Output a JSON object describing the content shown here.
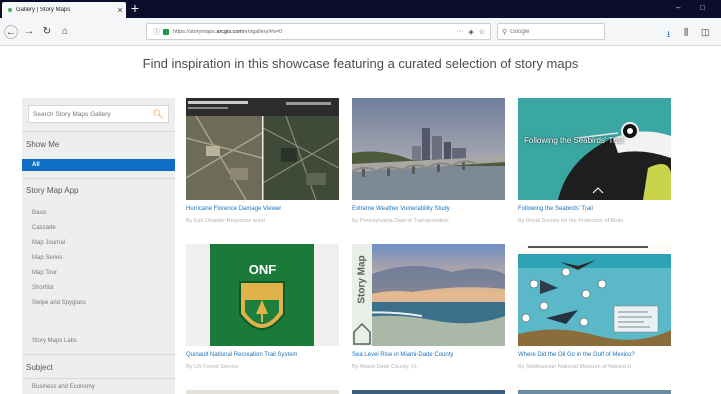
{
  "browser": {
    "tab_title": "Gallery | Story Maps",
    "tab_close": "×",
    "new_tab": "+",
    "minimize": "–",
    "maximize": "□",
    "url_prefix": "https://storymaps.",
    "url_domain": "arcgis.com",
    "url_suffix": "/en/gallery/#s=0",
    "url_more": "···",
    "search_placeholder": "Google",
    "icons": [
      "back-arrow-icon",
      "forward-arrow-icon",
      "reload-icon",
      "home-icon",
      "info-icon",
      "lock-icon",
      "pocket-icon",
      "bookmark-star-icon",
      "search-icon",
      "download-icon",
      "library-icon",
      "sidebar-icon"
    ]
  },
  "header": {
    "headline": "Find inspiration in this showcase featuring a curated selection of story maps"
  },
  "sidebar": {
    "search_placeholder": "Search Story Maps Gallery",
    "show_me": "Show Me",
    "all": "All",
    "story_map_app": "Story Map App",
    "app_items": [
      "Basic",
      "Cascade",
      "Map Journal",
      "Map Series",
      "Map Tour",
      "Shortlist",
      "Swipe and Spyglass"
    ],
    "labs": "Story Maps Labs",
    "subject": "Subject",
    "subject_items": [
      "Business and Economy"
    ]
  },
  "gallery": {
    "cards": [
      {
        "title": "Hurricane Florence Damage Viewer",
        "byline": "By Esri Disaster Response team"
      },
      {
        "title": "Extreme Weather Vulnerability Study",
        "byline": "By Pennsylvania Dept of Transportation"
      },
      {
        "title": "Following the Seabirds' Trail",
        "byline": "By Royal Society for the Protection of Birds",
        "overlay": "Following the Seabirds' Trail"
      },
      {
        "title": "Quinault National Recreation Trail System",
        "byline": "By US Forest Service",
        "overlay": "ONF"
      },
      {
        "title": "Sea Level Rise in Miami-Dade County",
        "byline": "By Miami-Dade County, FL",
        "overlay": "Story Map"
      },
      {
        "title": "Where Did the Oil Go in the Gulf of Mexico?",
        "byline": "By Smithsonian National Museum of Natural H"
      }
    ]
  },
  "colors": {
    "tabbar": "#0c0c2b",
    "accent_blue": "#0f6fc6",
    "link_blue": "#1f72b8",
    "search_orange": "#e58a2c",
    "sidebar_bg": "#eeeeee"
  }
}
